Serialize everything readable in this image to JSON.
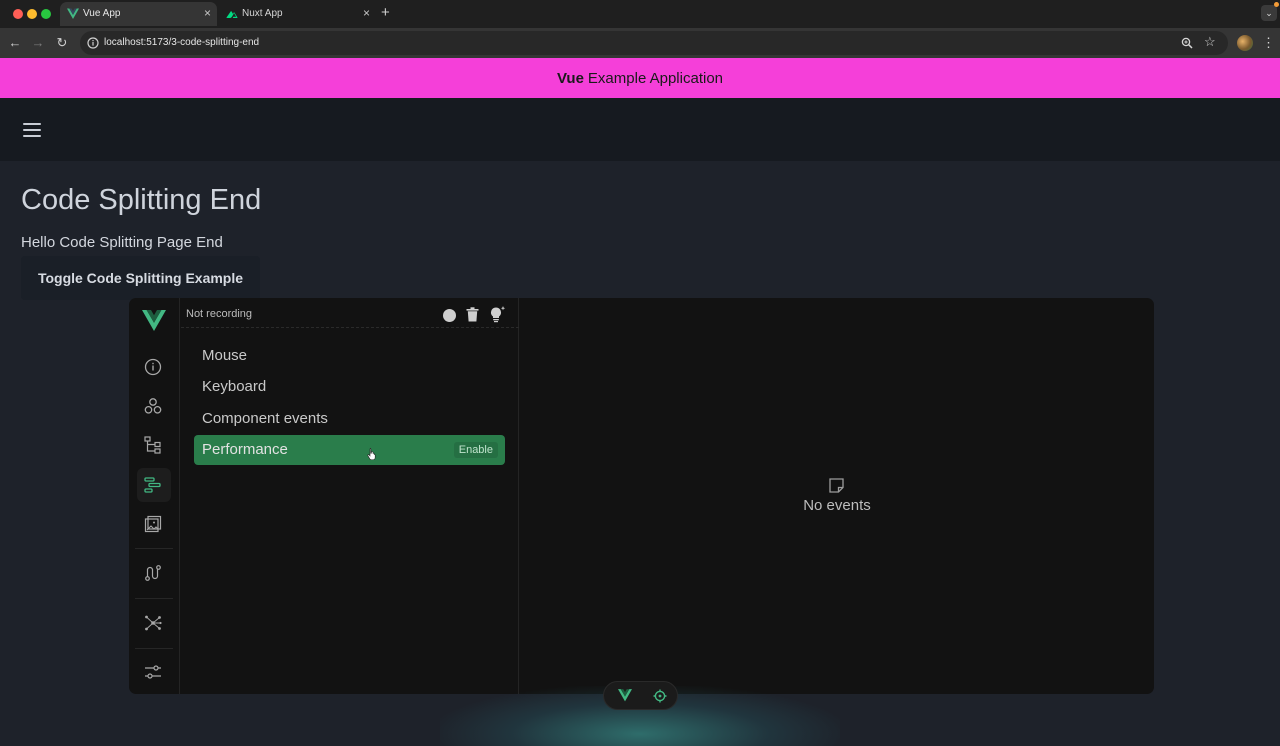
{
  "browser": {
    "tabs": [
      {
        "title": "Vue App",
        "active": true
      },
      {
        "title": "Nuxt App",
        "active": false
      }
    ],
    "url": "localhost:5173/3-code-splitting-end"
  },
  "app": {
    "banner_strong": "Vue",
    "banner_rest": "Example Application",
    "banner_color": "#f53fd9"
  },
  "page": {
    "title": "Code Splitting End",
    "subtitle": "Hello Code Splitting Page End",
    "toggle_label": "Toggle Code Splitting Example"
  },
  "devtools": {
    "status": "Not recording",
    "layers": [
      {
        "label": "Mouse",
        "selected": false
      },
      {
        "label": "Keyboard",
        "selected": false
      },
      {
        "label": "Component events",
        "selected": false
      },
      {
        "label": "Performance",
        "selected": true,
        "action": "Enable"
      }
    ],
    "empty_message": "No events",
    "accent_color": "#42b883"
  }
}
